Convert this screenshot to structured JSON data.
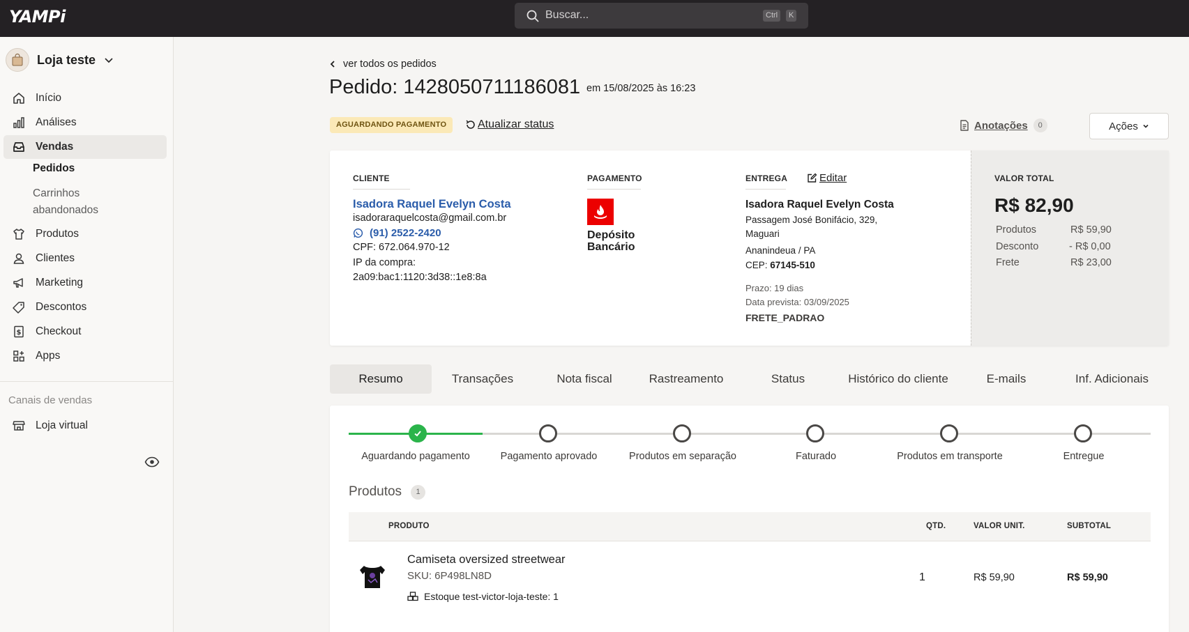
{
  "topbar": {
    "logo": "YAMPi",
    "search_placeholder": "Buscar...",
    "shortcut_ctrl": "Ctrl",
    "shortcut_key": "K"
  },
  "sidebar": {
    "store_name": "Loja teste",
    "items": [
      {
        "label": "Início",
        "icon": "home-icon"
      },
      {
        "label": "Análises",
        "icon": "chart-icon"
      },
      {
        "label": "Vendas",
        "icon": "inbox-icon"
      },
      {
        "label": "Produtos",
        "icon": "shirt-icon"
      },
      {
        "label": "Clientes",
        "icon": "user-icon"
      },
      {
        "label": "Marketing",
        "icon": "megaphone-icon"
      },
      {
        "label": "Descontos",
        "icon": "tag-icon"
      },
      {
        "label": "Checkout",
        "icon": "receipt-icon"
      },
      {
        "label": "Apps",
        "icon": "apps-icon"
      }
    ],
    "sub_items": {
      "pedidos": "Pedidos",
      "carrinhos_1": "Carrinhos",
      "carrinhos_2": "abandonados"
    },
    "channels_header": "Canais de vendas",
    "channel_item": "Loja virtual"
  },
  "order": {
    "back_link": "ver todos os pedidos",
    "title": "Pedido: 1428050711186081",
    "date": "em 15/08/2025 às 16:23",
    "status_badge": "AGUARDANDO PAGAMENTO",
    "update_status": "Atualizar status",
    "notes_label": "Anotações",
    "notes_count": "0",
    "actions_label": "Ações"
  },
  "client": {
    "section": "CLIENTE",
    "name": "Isadora Raquel Evelyn Costa",
    "email": "isadoraraquelcosta@gmail.com.br",
    "phone": "(91) 2522-2420",
    "cpf": "CPF: 672.064.970-12",
    "ip_label": "IP da compra:",
    "ip": "2a09:bac1:1120:3d38::1e8:8a"
  },
  "payment": {
    "section": "PAGAMENTO",
    "method_line1": "Depósito",
    "method_line2": "Bancário"
  },
  "delivery": {
    "section": "ENTREGA",
    "edit": "Editar",
    "name": "Isadora Raquel Evelyn Costa",
    "address1": "Passagem José Bonifácio, 329,",
    "address2": "Maguari",
    "city": "Ananindeua / PA",
    "cep_label": "CEP:",
    "cep": "67145-510",
    "deadline": "Prazo: 19 dias",
    "expected": "Data prevista: 03/09/2025",
    "code": "FRETE_PADRAO"
  },
  "total": {
    "section": "VALOR TOTAL",
    "value": "R$ 82,90",
    "rows": [
      {
        "label": "Produtos",
        "value": "R$ 59,90"
      },
      {
        "label": "Desconto",
        "value": "- R$ 0,00"
      },
      {
        "label": "Frete",
        "value": "R$ 23,00"
      }
    ]
  },
  "tabs": [
    "Resumo",
    "Transações",
    "Nota fiscal",
    "Rastreamento",
    "Status",
    "Histórico do cliente",
    "E-mails",
    "Inf. Adicionais"
  ],
  "progress": {
    "steps": [
      "Aguardando pagamento",
      "Pagamento aprovado",
      "Produtos em separação",
      "Faturado",
      "Produtos em transporte",
      "Entregue"
    ],
    "completed_steps": 1
  },
  "products": {
    "title": "Produtos",
    "count": "1",
    "headers": {
      "product": "PRODUTO",
      "qty": "QTD.",
      "unit": "VALOR UNIT.",
      "subtotal": "SUBTOTAL"
    },
    "items": [
      {
        "name": "Camiseta oversized streetwear",
        "sku": "SKU: 6P498LN8D",
        "stock": "Estoque test-victor-loja-teste: 1",
        "qty": "1",
        "unit": "R$ 59,90",
        "subtotal": "R$ 59,90"
      }
    ]
  },
  "colors": {
    "topbar": "#242124",
    "accent_blue": "#2a5caa",
    "success_green": "#2bb44b",
    "status_badge_bg": "#fbe9b7",
    "bank_red": "#ec0000"
  }
}
